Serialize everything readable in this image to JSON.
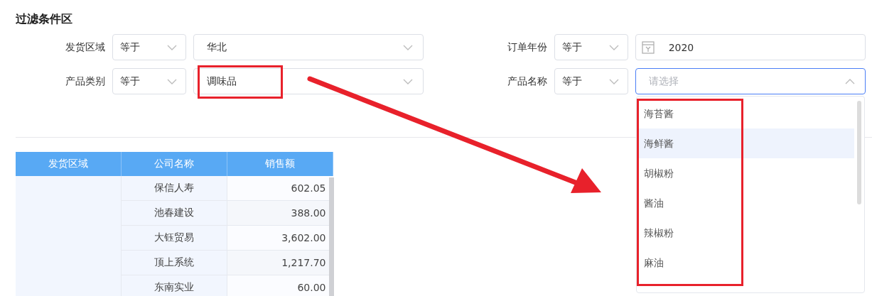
{
  "section_title": "过滤条件区",
  "filters": [
    {
      "label": "发货区域",
      "operator": "等于",
      "kind": "select",
      "value": "华北",
      "open": false
    },
    {
      "label": "订单年份",
      "operator": "等于",
      "kind": "year",
      "value": "2020",
      "open": false
    },
    {
      "label": "产品类别",
      "operator": "等于",
      "kind": "select",
      "value": "调味品",
      "open": false
    },
    {
      "label": "产品名称",
      "operator": "等于",
      "kind": "select",
      "placeholder": "请选择",
      "open": true
    }
  ],
  "dropdown_options": [
    {
      "label": "海苔酱",
      "highlighted": false
    },
    {
      "label": "海鲜酱",
      "highlighted": true
    },
    {
      "label": "胡椒粉",
      "highlighted": false
    },
    {
      "label": "酱油",
      "highlighted": false
    },
    {
      "label": "辣椒粉",
      "highlighted": false
    },
    {
      "label": "麻油",
      "highlighted": false
    }
  ],
  "table": {
    "columns": [
      "发货区域",
      "公司名称",
      "销售额"
    ],
    "rows": [
      {
        "company": "保信人寿",
        "sales": "602.05"
      },
      {
        "company": "池春建设",
        "sales": "388.00"
      },
      {
        "company": "大钰贸易",
        "sales": "3,602.00"
      },
      {
        "company": "顶上系统",
        "sales": "1,217.70"
      },
      {
        "company": "东南实业",
        "sales": "60.00"
      }
    ]
  }
}
